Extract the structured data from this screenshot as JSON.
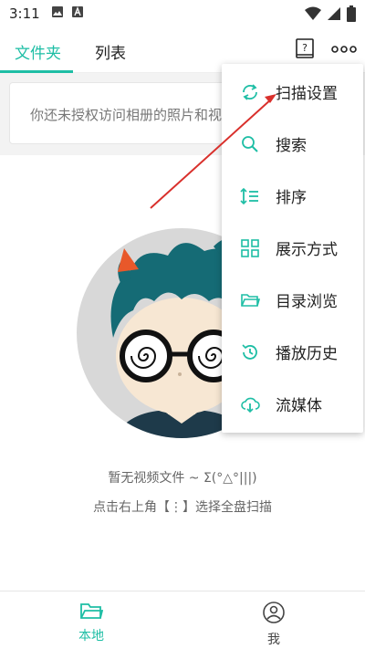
{
  "status_bar": {
    "time": "3:11"
  },
  "tabs": [
    {
      "label": "文件夹",
      "active": true
    },
    {
      "label": "列表",
      "active": false
    }
  ],
  "notice": {
    "text": "你还未授权访问相册的照片和视频"
  },
  "empty_state": {
    "line1": "暂无视频文件 ~ Σ(°△°|||)",
    "line2": "点击右上角【⋮】选择全盘扫描"
  },
  "menu": {
    "items": [
      {
        "label": "扫描设置",
        "icon": "sync-icon"
      },
      {
        "label": "搜索",
        "icon": "search-icon"
      },
      {
        "label": "排序",
        "icon": "sort-icon"
      },
      {
        "label": "展示方式",
        "icon": "layout-icon"
      },
      {
        "label": "目录浏览",
        "icon": "folder-open-icon"
      },
      {
        "label": "播放历史",
        "icon": "history-icon"
      },
      {
        "label": "流媒体",
        "icon": "cloud-download-icon"
      }
    ]
  },
  "bottom_nav": [
    {
      "label": "本地",
      "icon": "folder-icon",
      "active": true
    },
    {
      "label": "我",
      "icon": "profile-icon",
      "active": false
    }
  ],
  "colors": {
    "accent": "#1ebea5",
    "arrow": "#d9302c"
  }
}
